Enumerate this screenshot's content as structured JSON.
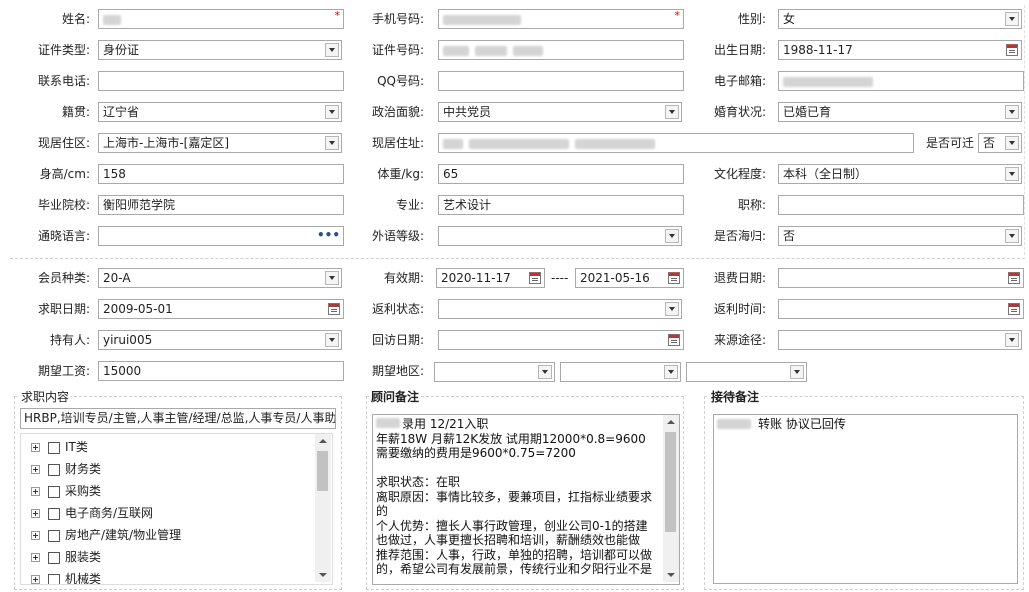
{
  "form": {
    "name_label": "姓名:",
    "mobile_label": "手机号码:",
    "gender_label": "性别:",
    "gender_value": "女",
    "idtype_label": "证件类型:",
    "idtype_value": "身份证",
    "idno_label": "证件号码:",
    "birth_label": "出生日期:",
    "birth_value": "1988-11-17",
    "phone_label": "联系电话:",
    "qq_label": "QQ号码:",
    "email_label": "电子邮箱:",
    "native_label": "籍贯:",
    "native_value": "辽宁省",
    "political_label": "政治面貌:",
    "political_value": "中共党员",
    "marital_label": "婚育状况:",
    "marital_value": "已婚已育",
    "residence_label": "现居住区:",
    "residence_value": "上海市-上海市-[嘉定区]",
    "address_label": "现居住址:",
    "relocate_label": "是否可迁",
    "relocate_value": "否",
    "height_label": "身高/cm:",
    "height_value": "158",
    "weight_label": "体重/kg:",
    "weight_value": "65",
    "education_label": "文化程度:",
    "education_value": "本科（全日制）",
    "school_label": "毕业院校:",
    "school_value": "衡阳师范学院",
    "major_label": "专业:",
    "major_value": "艺术设计",
    "title_label": "职称:",
    "language_label": "通晓语言:",
    "foreign_label": "外语等级:",
    "overseas_label": "是否海归:",
    "overseas_value": "否"
  },
  "member": {
    "type_label": "会员种类:",
    "type_value": "20-A",
    "valid_label": "有效期:",
    "valid_from": "2020-11-17",
    "valid_sep": "----",
    "valid_to": "2021-05-16",
    "refund_label": "退费日期:",
    "jobdate_label": "求职日期:",
    "jobdate_value": "2009-05-01",
    "rebate_status_label": "返利状态:",
    "rebate_time_label": "返利时间:",
    "holder_label": "持有人:",
    "holder_value": "yirui005",
    "visit_label": "回访日期:",
    "source_label": "来源途径:",
    "salary_label": "期望工资:",
    "salary_value": "15000",
    "area_label": "期望地区:"
  },
  "job_panel": {
    "title": "求职内容",
    "summary": "HRBP,培训专员/主管,人事主管/经理/总监,人事专员/人事助",
    "tree": [
      "IT类",
      "财务类",
      "采购类",
      "电子商务/互联网",
      "房地产/建筑/物业管理",
      "服装类",
      "机械类"
    ]
  },
  "consultant_panel": {
    "title": "顾问备注",
    "note": "录用 12/21入职\n年薪18W 月薪12K发放 试用期12000*0.8=9600\n需要缴纳的费用是9600*0.75=7200\n\n求职状态：在职\n离职原因：事情比较多，要兼项目，扛指标业绩要求的\n个人优势：擅长人事行政管理，创业公司0-1的搭建也做过，人事更擅长招聘和培训，薪酬绩效也能做\n推荐范围：人事，行政，单独的招聘，培训都可以做的，希望公司有发展前景，传统行业和夕阳行业不是"
  },
  "reception_panel": {
    "title": "接待备注",
    "note": "转账 协议已回传"
  },
  "icons": {
    "dropdown": "chevron-down-icon",
    "calendar": "calendar-icon",
    "more": "ellipsis-icon",
    "expand": "plus-icon"
  },
  "colors": {
    "required": "#d00000",
    "border": "#a9a9a9"
  }
}
